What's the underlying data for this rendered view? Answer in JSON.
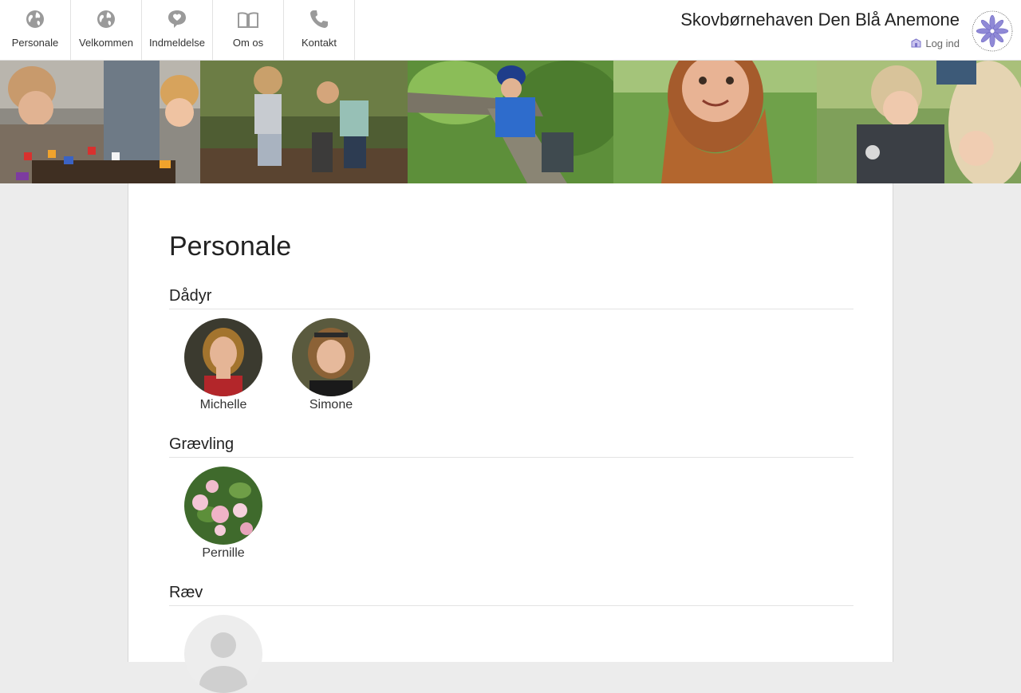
{
  "nav": {
    "items": [
      {
        "label": "Personale",
        "icon": "globe-icon"
      },
      {
        "label": "Velkommen",
        "icon": "globe-icon"
      },
      {
        "label": "Indmeldelse",
        "icon": "heart-speech-icon"
      },
      {
        "label": "Om os",
        "icon": "book-icon"
      },
      {
        "label": "Kontakt",
        "icon": "phone-icon"
      }
    ]
  },
  "header": {
    "site_title": "Skovbørnehaven Den Blå Anemone",
    "login_label": "Log ind",
    "logo_text": "Skovbørnehaven Den Blå Anemone"
  },
  "main": {
    "title": "Personale",
    "groups": [
      {
        "name": "Dådyr",
        "members": [
          {
            "name": "Michelle"
          },
          {
            "name": "Simone"
          }
        ]
      },
      {
        "name": "Grævling",
        "members": [
          {
            "name": "Pernille"
          }
        ]
      },
      {
        "name": "Ræv",
        "members": []
      }
    ]
  },
  "colors": {
    "background": "#ececec",
    "card": "#ffffff",
    "icon_gray": "#9a9a9a",
    "logo_purple": "#7b74c9"
  }
}
